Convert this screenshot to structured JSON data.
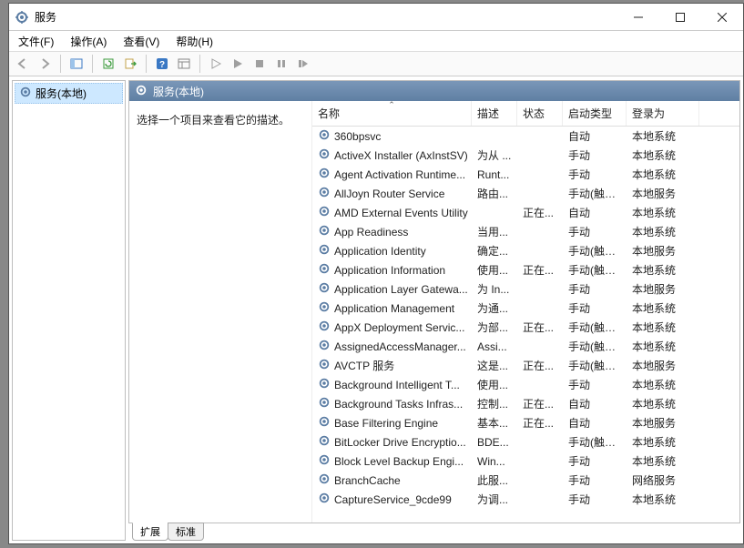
{
  "window": {
    "title": "服务"
  },
  "menu": {
    "file": "文件(F)",
    "action": "操作(A)",
    "view": "查看(V)",
    "help": "帮助(H)"
  },
  "tree": {
    "root": "服务(本地)"
  },
  "panel": {
    "header": "服务(本地)",
    "desc_prompt": "选择一个项目来查看它的描述。"
  },
  "columns": {
    "name": "名称",
    "desc": "描述",
    "status": "状态",
    "startup": "启动类型",
    "logon": "登录为"
  },
  "tabs": {
    "extended": "扩展",
    "standard": "标准"
  },
  "services": [
    {
      "name": "360bpsvc",
      "desc": "",
      "status": "",
      "startup": "自动",
      "logon": "本地系统"
    },
    {
      "name": "ActiveX Installer (AxInstSV)",
      "desc": "为从 ...",
      "status": "",
      "startup": "手动",
      "logon": "本地系统"
    },
    {
      "name": "Agent Activation Runtime...",
      "desc": "Runt...",
      "status": "",
      "startup": "手动",
      "logon": "本地系统"
    },
    {
      "name": "AllJoyn Router Service",
      "desc": "路由...",
      "status": "",
      "startup": "手动(触发...",
      "logon": "本地服务"
    },
    {
      "name": "AMD External Events Utility",
      "desc": "",
      "status": "正在...",
      "startup": "自动",
      "logon": "本地系统"
    },
    {
      "name": "App Readiness",
      "desc": "当用...",
      "status": "",
      "startup": "手动",
      "logon": "本地系统"
    },
    {
      "name": "Application Identity",
      "desc": "确定...",
      "status": "",
      "startup": "手动(触发...",
      "logon": "本地服务"
    },
    {
      "name": "Application Information",
      "desc": "使用...",
      "status": "正在...",
      "startup": "手动(触发...",
      "logon": "本地系统"
    },
    {
      "name": "Application Layer Gatewa...",
      "desc": "为 In...",
      "status": "",
      "startup": "手动",
      "logon": "本地服务"
    },
    {
      "name": "Application Management",
      "desc": "为通...",
      "status": "",
      "startup": "手动",
      "logon": "本地系统"
    },
    {
      "name": "AppX Deployment Servic...",
      "desc": "为部...",
      "status": "正在...",
      "startup": "手动(触发...",
      "logon": "本地系统"
    },
    {
      "name": "AssignedAccessManager...",
      "desc": "Assi...",
      "status": "",
      "startup": "手动(触发...",
      "logon": "本地系统"
    },
    {
      "name": "AVCTP 服务",
      "desc": "这是...",
      "status": "正在...",
      "startup": "手动(触发...",
      "logon": "本地服务"
    },
    {
      "name": "Background Intelligent T...",
      "desc": "使用...",
      "status": "",
      "startup": "手动",
      "logon": "本地系统"
    },
    {
      "name": "Background Tasks Infras...",
      "desc": "控制...",
      "status": "正在...",
      "startup": "自动",
      "logon": "本地系统"
    },
    {
      "name": "Base Filtering Engine",
      "desc": "基本...",
      "status": "正在...",
      "startup": "自动",
      "logon": "本地服务"
    },
    {
      "name": "BitLocker Drive Encryptio...",
      "desc": "BDE...",
      "status": "",
      "startup": "手动(触发...",
      "logon": "本地系统"
    },
    {
      "name": "Block Level Backup Engi...",
      "desc": "Win...",
      "status": "",
      "startup": "手动",
      "logon": "本地系统"
    },
    {
      "name": "BranchCache",
      "desc": "此服...",
      "status": "",
      "startup": "手动",
      "logon": "网络服务"
    },
    {
      "name": "CaptureService_9cde99",
      "desc": "为调...",
      "status": "",
      "startup": "手动",
      "logon": "本地系统"
    }
  ]
}
